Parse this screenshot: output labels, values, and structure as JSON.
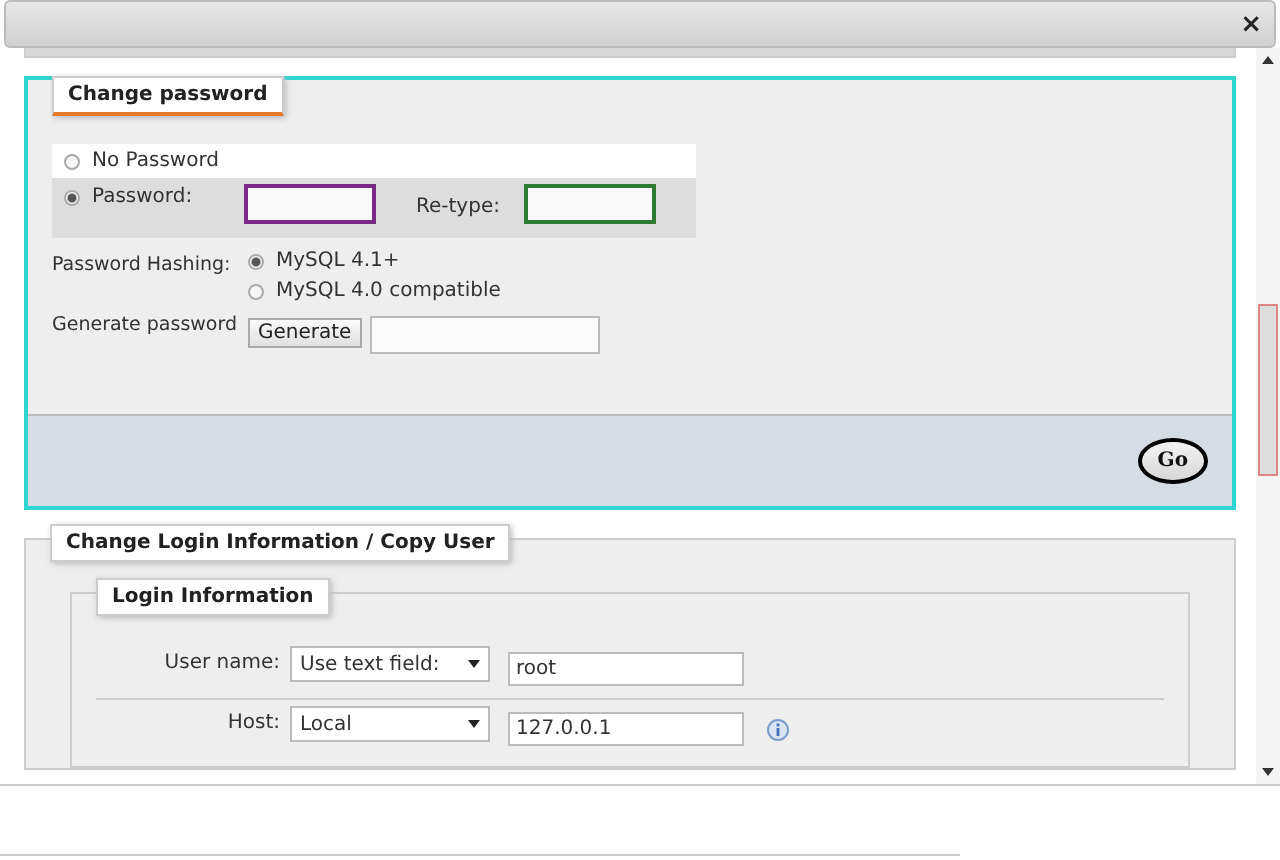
{
  "dialog": {
    "close": "×"
  },
  "change_password": {
    "legend": "Change password",
    "options": [
      {
        "label": "No Password",
        "selected": false
      },
      {
        "label": "Password:",
        "selected": true
      }
    ],
    "retype_label": "Re-type:",
    "hashing_label": "Password Hashing:",
    "hashing": [
      {
        "label": "MySQL 4.1+",
        "selected": true
      },
      {
        "label": "MySQL 4.0 compatible",
        "selected": false
      }
    ],
    "generate_label": "Generate password",
    "generate_button": "Generate",
    "go_button": "Go"
  },
  "login_section": {
    "legend": "Change Login Information / Copy User",
    "inner_legend": "Login Information",
    "rows": [
      {
        "label": "User name:",
        "select": "Use text field:",
        "value": "root",
        "info": false
      },
      {
        "label": "Host:",
        "select": "Local",
        "value": "127.0.0.1",
        "info": true
      }
    ]
  }
}
